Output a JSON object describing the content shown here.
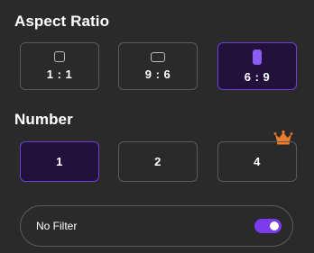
{
  "aspect_ratio": {
    "title": "Aspect Ratio",
    "options": [
      {
        "label": "1 : 1",
        "icon": "square-ratio-icon",
        "selected": false
      },
      {
        "label": "9 : 6",
        "icon": "landscape-ratio-icon",
        "selected": false
      },
      {
        "label": "6 : 9",
        "icon": "portrait-ratio-icon",
        "selected": true
      }
    ]
  },
  "number": {
    "title": "Number",
    "options": [
      {
        "label": "1",
        "selected": true
      },
      {
        "label": "2",
        "selected": false
      },
      {
        "label": "4",
        "selected": false,
        "badge_icon": "crown-icon"
      }
    ]
  },
  "filter": {
    "label": "No Filter",
    "toggle_on": true
  },
  "colors": {
    "background": "#2a2a2a",
    "accent": "#7c3aed",
    "selected_fill": "#22123b",
    "crown": "#f07c2a"
  }
}
